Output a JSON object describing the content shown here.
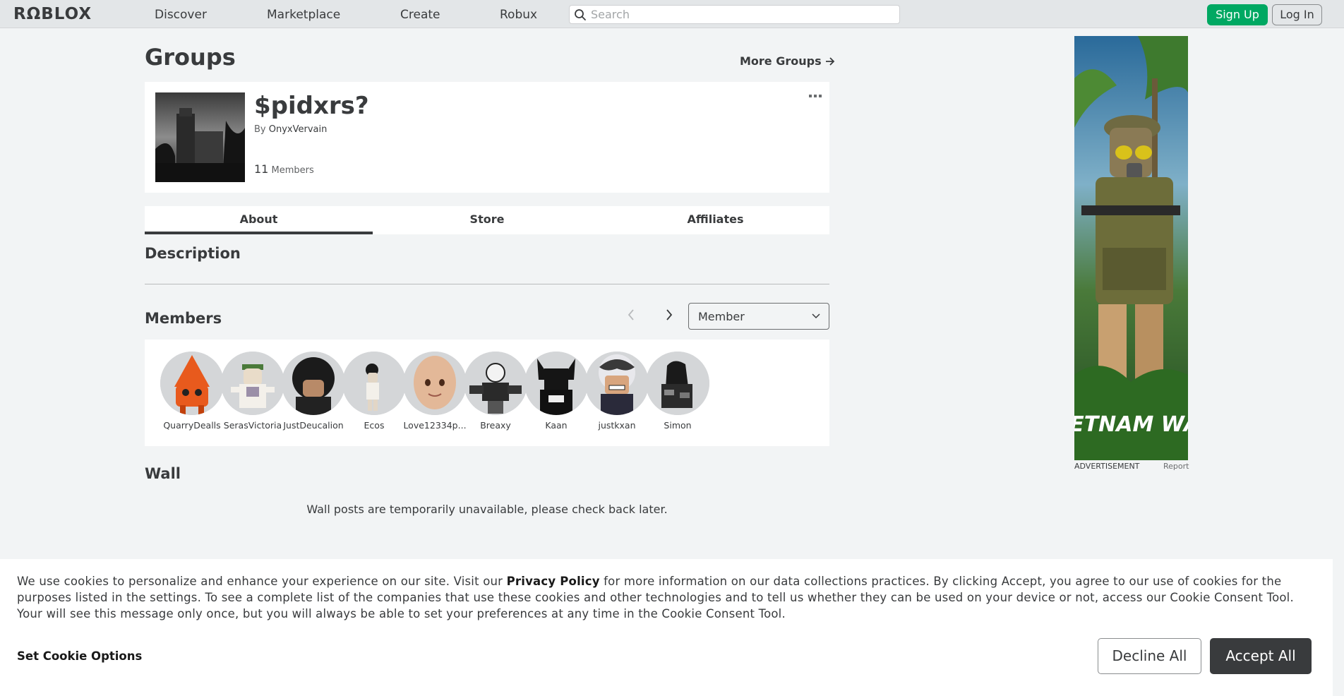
{
  "header": {
    "logo": "RΩBLOX",
    "nav": [
      "Discover",
      "Marketplace",
      "Create",
      "Robux"
    ],
    "search_placeholder": "Search",
    "signup": "Sign Up",
    "login": "Log In"
  },
  "page": {
    "title": "Groups",
    "more_groups": "More Groups"
  },
  "group": {
    "name": "$pidxrs?",
    "by": "By",
    "owner": "OnyxVervain",
    "member_count": "11",
    "members_label": "Members"
  },
  "tabs": [
    "About",
    "Store",
    "Affiliates"
  ],
  "sections": {
    "description": "Description",
    "members": "Members",
    "wall": "Wall"
  },
  "role_select": "Member",
  "members": [
    {
      "name": "QuarryDealls"
    },
    {
      "name": "SerasVictoria"
    },
    {
      "name": "JustDeucalion"
    },
    {
      "name": "Ecos"
    },
    {
      "name": "Love12334p..."
    },
    {
      "name": "Breaxy"
    },
    {
      "name": "Kaan"
    },
    {
      "name": "justkxan"
    },
    {
      "name": "Simon"
    }
  ],
  "wall_message": "Wall posts are temporarily unavailable, please check back later.",
  "ad": {
    "label": "ADVERTISEMENT",
    "report": "Report",
    "art_text": "VIETNAM WAR"
  },
  "cookie": {
    "text_before": "We use cookies to personalize and enhance your experience on our site. Visit our ",
    "privacy_link": "Privacy Policy",
    "text_after": " for more information on our data collections practices. By clicking Accept, you agree to our use of cookies for the purposes listed in the settings. To see a complete list of the companies that use these cookies and other technologies and to tell us whether they can be used on your device or not, access our Cookie Consent Tool. Your will see this message only once, but you will always be able to set your preferences at any time in the Cookie Consent Tool.",
    "set_options": "Set Cookie Options",
    "decline": "Decline All",
    "accept": "Accept All"
  }
}
